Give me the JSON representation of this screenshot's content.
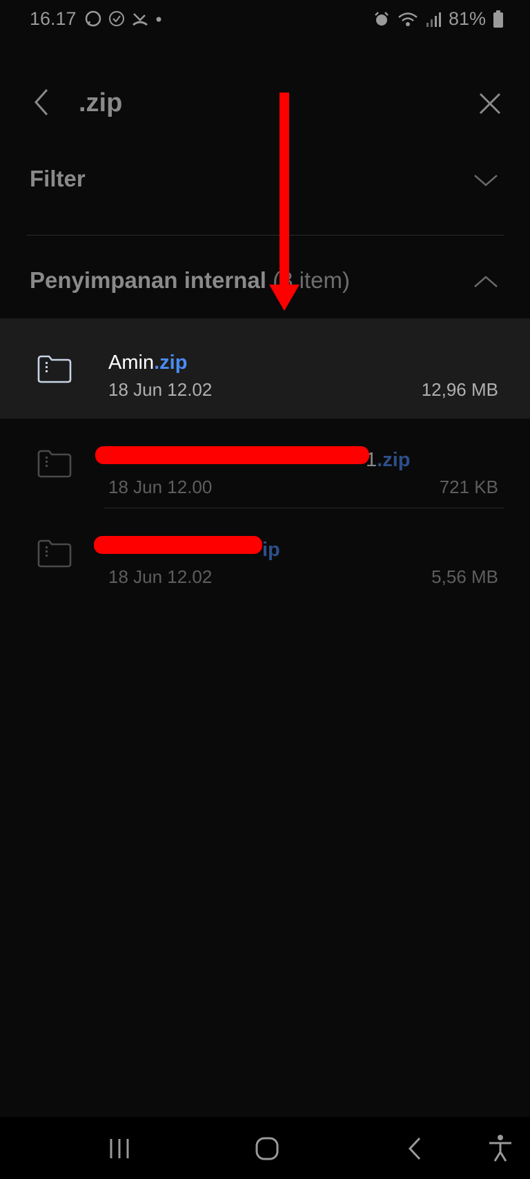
{
  "status_bar": {
    "time": "16.17",
    "battery": "81%"
  },
  "search": {
    "query": ".zip"
  },
  "filter": {
    "label": "Filter"
  },
  "section": {
    "title": "Penyimpanan internal",
    "count": "(3 item)"
  },
  "files": [
    {
      "name": "Amin",
      "ext": ".zip",
      "date": "18 Jun 12.02",
      "size": "12,96 MB",
      "selected": true
    },
    {
      "name": "1",
      "ext": ".zip",
      "date": "18 Jun 12.00",
      "size": "721 KB",
      "selected": false
    },
    {
      "name": "",
      "ext": "ip",
      "date": "18 Jun 12.02",
      "size": "5,56 MB",
      "selected": false
    }
  ],
  "colors": {
    "accent": "#4a8cf2",
    "annotation": "#ff0000"
  },
  "icons": {
    "back": "chevron-left-icon",
    "clear": "close-icon",
    "filter_toggle": "chevron-down-icon",
    "section_toggle": "chevron-up-icon",
    "file": "zip-folder-icon"
  }
}
